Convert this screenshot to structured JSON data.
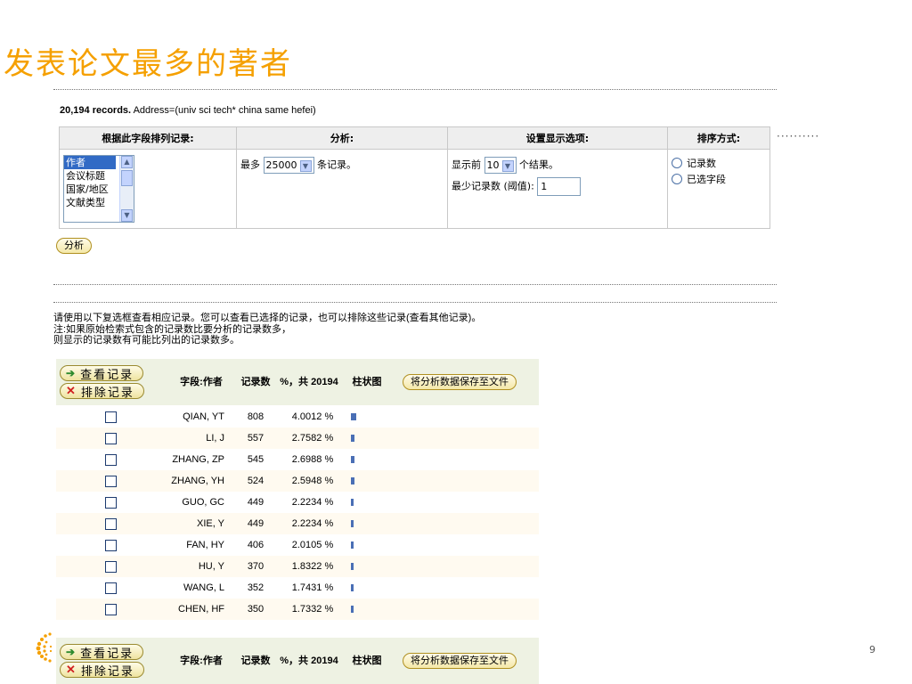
{
  "slide": {
    "title": "发表论文最多的著者",
    "page_number": "9",
    "dots": "··········"
  },
  "records": {
    "count": "20,194 records.",
    "query": " Address=(univ sci tech* china same hefei)"
  },
  "options": {
    "headers": [
      "根据此字段排列记录:",
      "分析:",
      "设置显示选项:",
      "排序方式:"
    ],
    "field_list": [
      "作者",
      "会议标题",
      "国家/地区",
      "文献类型"
    ],
    "analyze_prefix": "最多",
    "analyze_value": "25000",
    "analyze_suffix": "条记录。",
    "show_prefix": "显示前",
    "show_value": "10",
    "show_suffix": "个结果。",
    "min_label": "最少记录数 (阈值):",
    "min_value": "1",
    "sort_options": [
      "记录数",
      "已选字段"
    ]
  },
  "analyze_button": "分析",
  "notes": {
    "line1": "请使用以下复选框查看相应记录。您可以查看已选择的记录，也可以排除这些记录(查看其他记录)。",
    "line2": "注:如果原始检索式包含的记录数比要分析的记录数多，",
    "line3": "则显示的记录数有可能比列出的记录数多。"
  },
  "results": {
    "view_button": "查看记录",
    "exclude_button": "排除记录",
    "col_field": "字段:作者",
    "col_count": "记录数",
    "col_pct": "%，共 20194",
    "col_bar": "柱状图",
    "save_button": "将分析数据保存至文件",
    "rows": [
      {
        "name": "QIAN, YT",
        "count": "808",
        "pct": "4.0012 %",
        "pct_value": 4.0012
      },
      {
        "name": "LI, J",
        "count": "557",
        "pct": "2.7582 %",
        "pct_value": 2.7582
      },
      {
        "name": "ZHANG, ZP",
        "count": "545",
        "pct": "2.6988 %",
        "pct_value": 2.6988
      },
      {
        "name": "ZHANG, YH",
        "count": "524",
        "pct": "2.5948 %",
        "pct_value": 2.5948
      },
      {
        "name": "GUO, GC",
        "count": "449",
        "pct": "2.2234 %",
        "pct_value": 2.2234
      },
      {
        "name": "XIE, Y",
        "count": "449",
        "pct": "2.2234 %",
        "pct_value": 2.2234
      },
      {
        "name": "FAN, HY",
        "count": "406",
        "pct": "2.0105 %",
        "pct_value": 2.0105
      },
      {
        "name": "HU, Y",
        "count": "370",
        "pct": "1.8322 %",
        "pct_value": 1.8322
      },
      {
        "name": "WANG, L",
        "count": "352",
        "pct": "1.7431 %",
        "pct_value": 1.7431
      },
      {
        "name": "CHEN, HF",
        "count": "350",
        "pct": "1.7332 %",
        "pct_value": 1.7332
      }
    ]
  },
  "colors": {
    "title": "#f5a000",
    "bar": "#4a6fb5",
    "header_bg": "#eef2e3"
  }
}
